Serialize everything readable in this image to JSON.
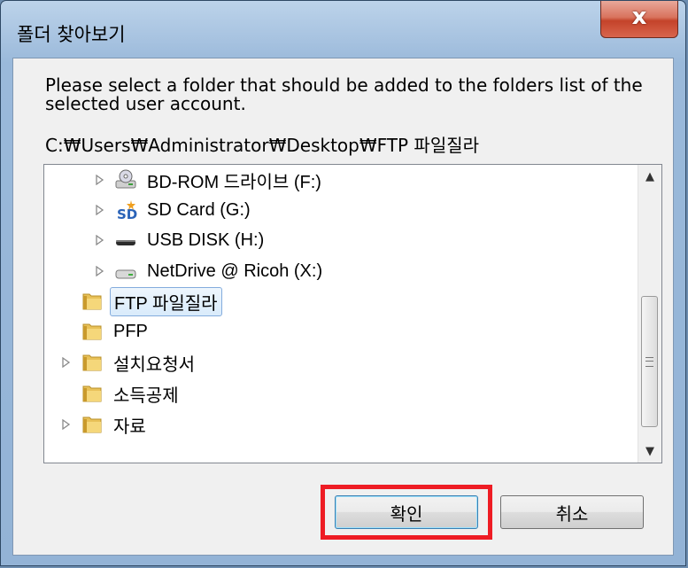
{
  "window": {
    "title": "폴더 찾아보기",
    "close_label": "x"
  },
  "dialog": {
    "description": "Please select a folder that should be added to the folders list of the selected user account.",
    "path": "C:₩Users₩Administrator₩Desktop₩FTP 파일질라"
  },
  "tree": {
    "items": [
      {
        "label": "BD-ROM 드라이브 (F:)",
        "icon": "bd-rom-drive-icon",
        "expandable": true,
        "level": 1
      },
      {
        "label": "SD Card (G:)",
        "icon": "sd-card-icon",
        "expandable": true,
        "level": 1
      },
      {
        "label": "USB DISK (H:)",
        "icon": "usb-drive-icon",
        "expandable": true,
        "level": 1
      },
      {
        "label": "NetDrive @ Ricoh (X:)",
        "icon": "network-drive-icon",
        "expandable": true,
        "level": 1
      },
      {
        "label": "FTP 파일질라",
        "icon": "folder-icon",
        "expandable": false,
        "level": 0,
        "selected": true
      },
      {
        "label": "PFP",
        "icon": "folder-icon",
        "expandable": false,
        "level": 0
      },
      {
        "label": "설치요청서",
        "icon": "folder-icon",
        "expandable": true,
        "level": 0
      },
      {
        "label": "소득공제",
        "icon": "folder-icon",
        "expandable": false,
        "level": 0
      },
      {
        "label": "자료",
        "icon": "folder-icon",
        "expandable": true,
        "level": 0
      }
    ]
  },
  "buttons": {
    "ok": "확인",
    "cancel": "취소"
  },
  "colors": {
    "highlight": "#ee1c24",
    "selection": "#d9ebfb"
  }
}
